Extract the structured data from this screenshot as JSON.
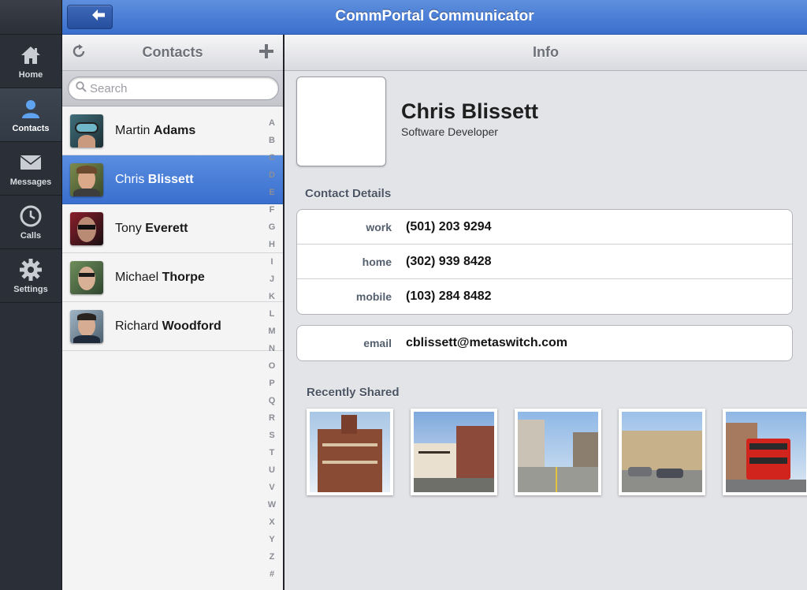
{
  "app": {
    "title": "CommPortal Communicator"
  },
  "nav": {
    "items": [
      {
        "label": "Home",
        "icon": "home-icon"
      },
      {
        "label": "Contacts",
        "icon": "person-icon"
      },
      {
        "label": "Messages",
        "icon": "envelope-icon"
      },
      {
        "label": "Calls",
        "icon": "clock-icon"
      },
      {
        "label": "Settings",
        "icon": "gear-icon"
      }
    ],
    "active": "Contacts"
  },
  "contacts_panel": {
    "title": "Contacts",
    "search_placeholder": "Search",
    "contacts": [
      {
        "first": "Martin",
        "last": "Adams"
      },
      {
        "first": "Chris",
        "last": "Blissett"
      },
      {
        "first": "Tony",
        "last": "Everett"
      },
      {
        "first": "Michael",
        "last": "Thorpe"
      },
      {
        "first": "Richard",
        "last": "Woodford"
      }
    ],
    "selected": "Chris Blissett",
    "index": [
      "A",
      "B",
      "C",
      "D",
      "E",
      "F",
      "G",
      "H",
      "I",
      "J",
      "K",
      "L",
      "M",
      "N",
      "O",
      "P",
      "Q",
      "R",
      "S",
      "T",
      "U",
      "V",
      "W",
      "X",
      "Y",
      "Z",
      "#"
    ]
  },
  "info_panel": {
    "title": "Info",
    "name": "Chris Blissett",
    "role": "Software Developer",
    "contact_details_title": "Contact Details",
    "phones": [
      {
        "label": "work",
        "value": "(501) 203 9294"
      },
      {
        "label": "home",
        "value": "(302) 939 8428"
      },
      {
        "label": "mobile",
        "value": "(103) 284 8482"
      }
    ],
    "email": {
      "label": "email",
      "value": "cblissett@metaswitch.com"
    },
    "recently_shared_title": "Recently Shared",
    "shared_photos": [
      "town-hall-photo",
      "tudor-buildings-photo",
      "high-street-photo",
      "terraced-houses-photo",
      "red-bus-photo"
    ]
  },
  "colors": {
    "accent": "#3a6fcd",
    "nav_bg": "#2b2f37",
    "panel_bg": "#e3e4e8"
  }
}
